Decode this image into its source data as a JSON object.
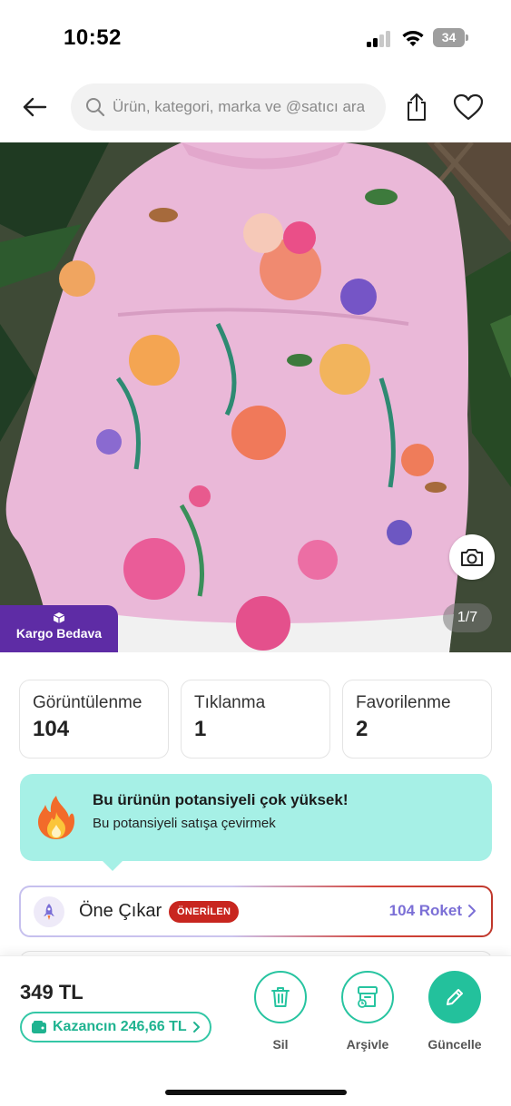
{
  "status_bar": {
    "time": "10:52",
    "battery": "34"
  },
  "nav": {
    "back_icon": "arrow-left-icon",
    "search_placeholder": "Ürün, kategori, marka ve @satıcı ara",
    "share_icon": "share-icon",
    "favorite_icon": "heart-icon"
  },
  "product_image": {
    "counter": "1/7",
    "badge": "Kargo Bedava",
    "camera_icon": "camera-icon"
  },
  "stats": [
    {
      "label": "Görüntülenme",
      "value": "104"
    },
    {
      "label": "Tıklanma",
      "value": "1"
    },
    {
      "label": "Favorilenme",
      "value": "2"
    }
  ],
  "potential": {
    "title": "Bu ürünün potansiyeli çok yüksek!",
    "subtitle": "Bu potansiyeli satışa çevirmek"
  },
  "boost": {
    "label": "Öne Çıkar",
    "badge": "ÖNERİLEN",
    "cta": "104 Roket"
  },
  "bottom_bar": {
    "price": "349 TL",
    "earnings": "Kazancın 246,66 TL",
    "actions": [
      {
        "label": "Sil",
        "icon": "trash-icon"
      },
      {
        "label": "Arşivle",
        "icon": "archive-icon"
      },
      {
        "label": "Güncelle",
        "icon": "pencil-icon"
      }
    ]
  },
  "colors": {
    "accent_green": "#23c19c",
    "badge_purple": "#5e2ca5",
    "potential_bg": "#a6f0e6",
    "recommended_red": "#c8261f",
    "rocket_purple": "#7b6fd6"
  }
}
